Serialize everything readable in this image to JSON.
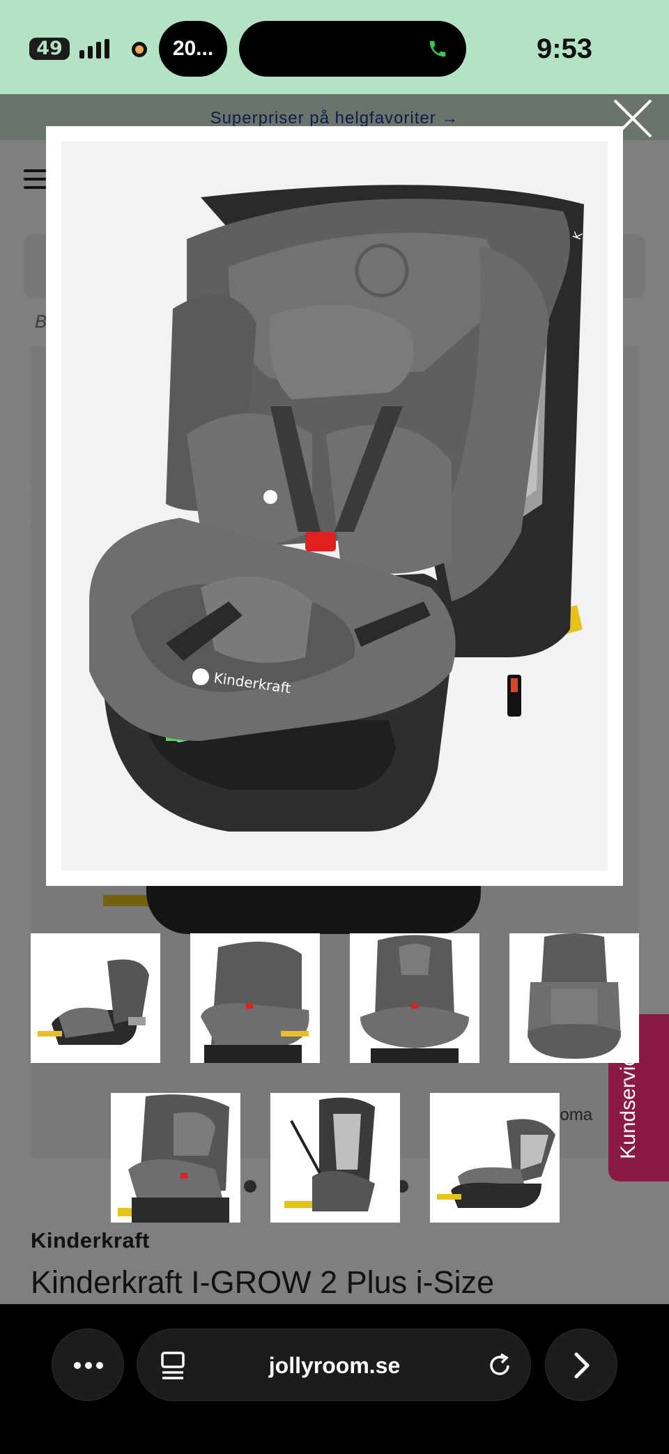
{
  "status_bar": {
    "battery": "49",
    "notification": "20...",
    "time": "9:53"
  },
  "site": {
    "promo_banner": "Superpriser på helgfavoriter →",
    "breadcrumb": "B",
    "zoom_hint": "ooma",
    "brand": "Kinderkraft",
    "product_title": "Kinderkraft I-GROW 2 Plus i-Size",
    "customer_service": "Kundservice"
  },
  "modal": {
    "image_logo_text": "Kinderkraft"
  },
  "browser": {
    "url": "jollyroom.se"
  },
  "icons": {
    "close": "close-icon",
    "prev": "chevron-left-icon",
    "next": "chevron-right-icon",
    "more": "more-icon",
    "tabs": "tabs-icon",
    "reload": "reload-icon",
    "forward": "chevron-right-icon"
  },
  "colors": {
    "status_bar": "#b3e3c4",
    "promo_text": "#1d3a8a",
    "customer_service_bg": "#8a1a45",
    "seat_gray": "#6b6b6b",
    "seat_dark": "#2e2e2e",
    "isofix_yellow": "#e7c31a"
  }
}
